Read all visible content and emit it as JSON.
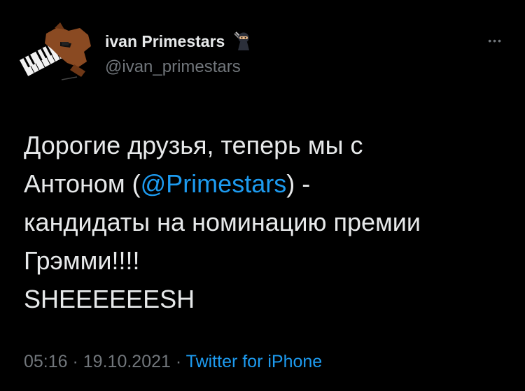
{
  "author": {
    "display_name": "ivan Primestars",
    "handle": "@ivan_primestars",
    "badge_icon": "ninja-emoji-icon",
    "avatar_icon": "dog-piano-avatar-icon"
  },
  "menu": {
    "more_label": "•••"
  },
  "tweet": {
    "line1": "Дорогие друзья, теперь мы с",
    "line2_before": "Антоном (",
    "line2_mention": "@Primestars",
    "line2_after": ") -",
    "line3": "кандидаты на номинацию премии",
    "line4": "Грэмми!!!!",
    "line5": "SHEEEEEESH"
  },
  "meta": {
    "time": "05:16",
    "sep1": " · ",
    "date": "19.10.2021",
    "sep2": " · ",
    "source": "Twitter for iPhone"
  },
  "colors": {
    "background": "#000000",
    "link": "#1d9bf0",
    "muted": "#71767b",
    "text": "#e7e9ea"
  }
}
